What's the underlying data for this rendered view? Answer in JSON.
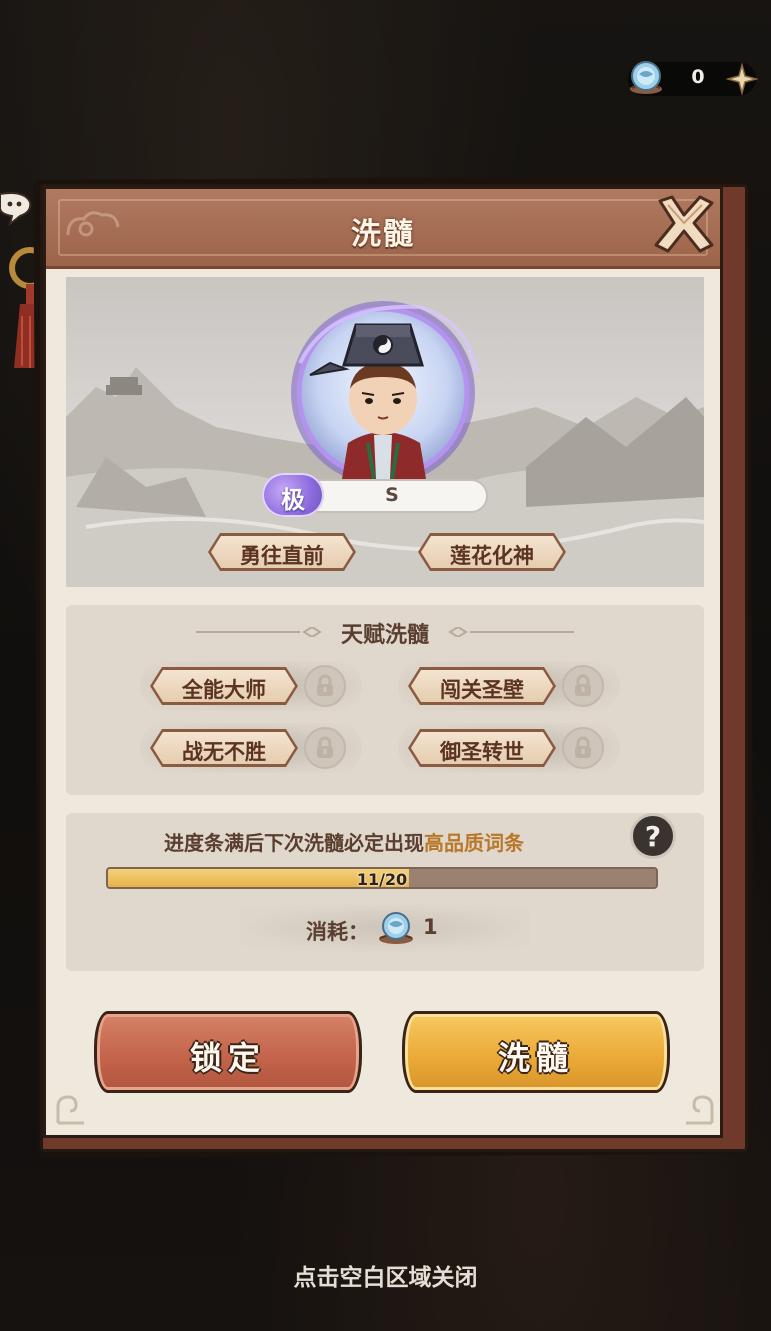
{
  "currency": {
    "amount": "0",
    "icon": "marrow-gem-icon",
    "add_icon": "plus-icon"
  },
  "modal": {
    "title": "洗髓",
    "close_icon": "close-icon"
  },
  "hero": {
    "grade_badge": "极",
    "grade_value": "S",
    "traits": [
      "勇往直前",
      "莲花化神"
    ]
  },
  "talents": {
    "title": "天赋洗髓",
    "items": [
      "全能大师",
      "闯关圣壁",
      "战无不胜",
      "御圣转世"
    ],
    "lock_icon": "lock-icon"
  },
  "progress": {
    "hint_prefix": "进度条满后下次洗髓必定出现",
    "hint_highlight": "高品质词条",
    "current": 11,
    "max": 20,
    "label": "11/20",
    "help_label": "?",
    "cost_label": "消耗：",
    "cost_amount": "1"
  },
  "buttons": {
    "lock_label": "锁定",
    "refine_label": "洗髓"
  },
  "dismiss_hint": "点击空白区域关闭",
  "colors": {
    "header": "#a56b50",
    "panel": "#e0d8cd",
    "highlight": "#b9772a",
    "lock_button": "#c2634a",
    "refine_button": "#eaa936",
    "progress_fill": "#e6b24a"
  }
}
